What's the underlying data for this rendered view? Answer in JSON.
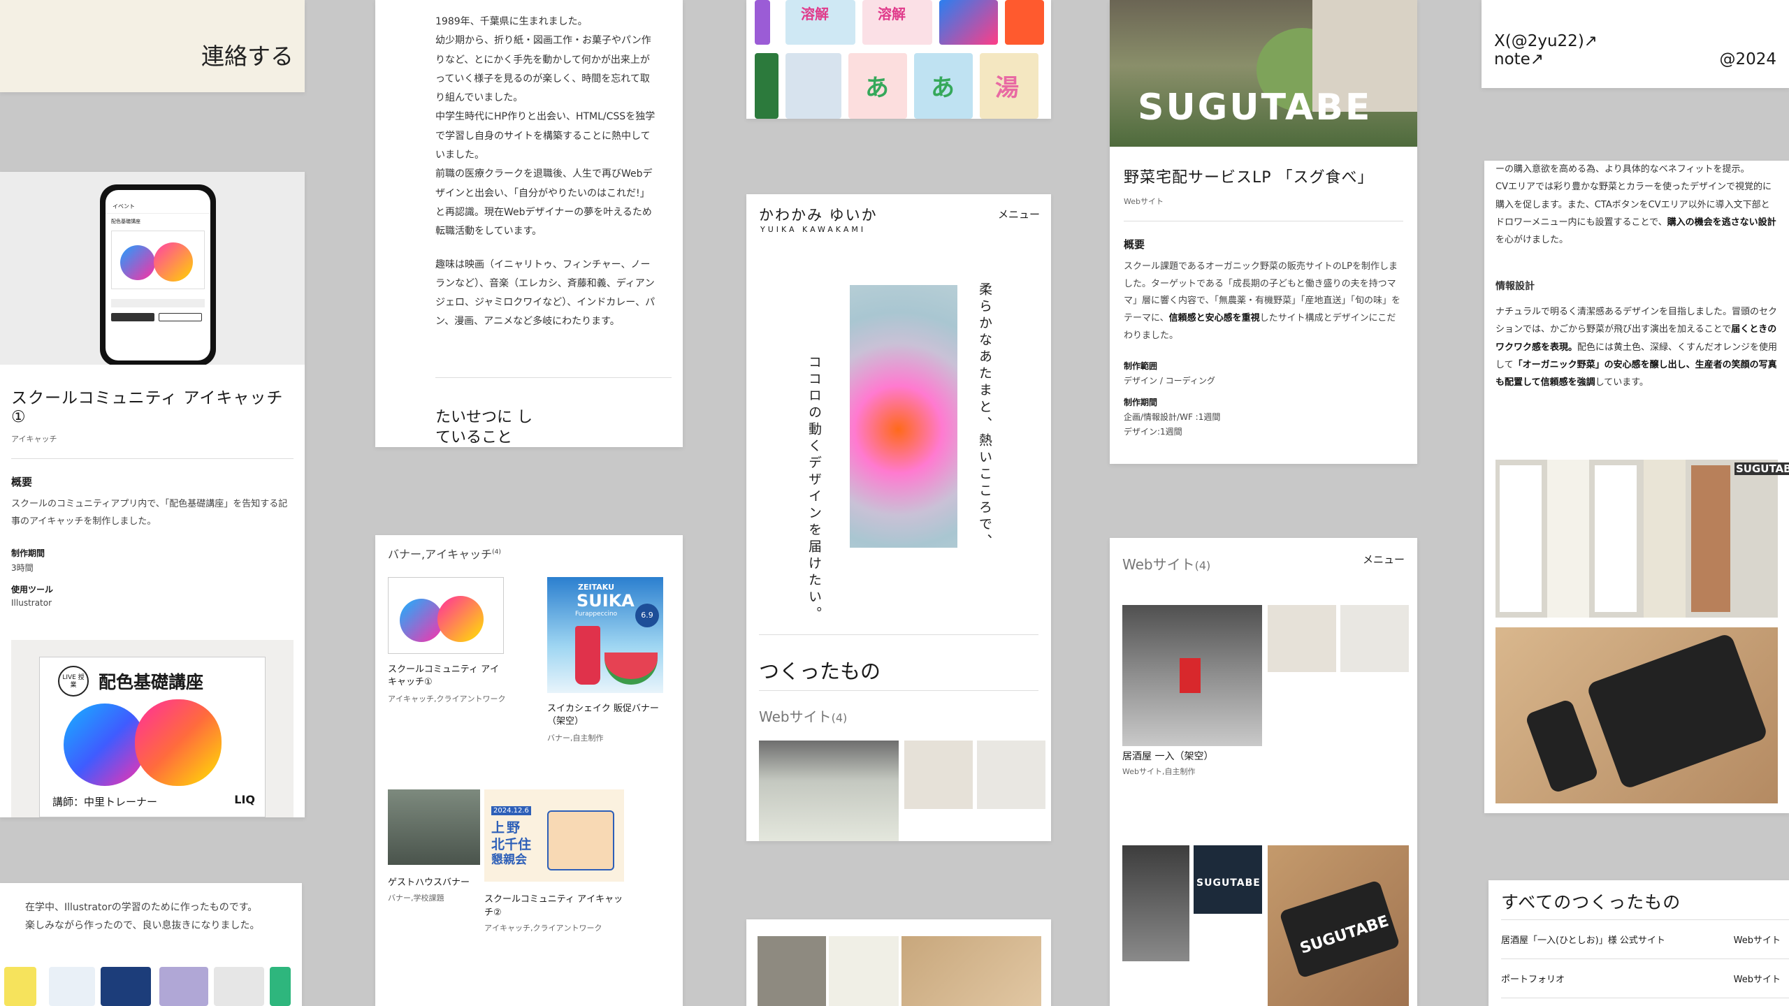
{
  "contact": {
    "label": "連絡する"
  },
  "card_school": {
    "title": "スクールコミュニティ アイキャッチ①",
    "category": "アイキャッチ",
    "overview_heading": "概要",
    "overview_text": "スクールのコミュニティアプリ内で、「配色基礎講座」を告知する記事のアイキャッチを制作しました。",
    "period_label": "制作期間",
    "period_value": "3時間",
    "tool_label": "使用ツール",
    "tool_value": "Illustrator",
    "phone_header": "イベント",
    "phone_sub": "配色基礎講座",
    "banner_live": "LIVE 授業",
    "banner_title": "配色基礎講座",
    "banner_teacher": "講師：中里トレーナー",
    "banner_brand": "LIQ"
  },
  "card_bio": {
    "p1": "1989年、千葉県に生まれました。",
    "p2": "幼少期から、折り紙・図画工作・お菓子やパン作りなど、とにかく手先を動かして何かが出来上がっていく様子を見るのが楽しく、時間を忘れて取り組んでいました。",
    "p3": "中学生時代にHP作りと出会い、HTML/CSSを独学で学習し自身のサイトを構築することに熱中していました。",
    "p4": "前職の医療クラークを退職後、人生で再びWebデザインと出会い、「自分がやりたいのはこれだ!」と再認識。現在Webデザイナーの夢を叶えるため転職活動をしています。",
    "p5": "趣味は映画（イニャリトゥ、フィンチャー、ノーランなど）、音楽（エレカシ、斉藤和義、ディアンジェロ、ジャミロクワイなど）、インドカレー、パン、漫画、アニメなど多岐にわたります。",
    "heading": "たいせつに していること"
  },
  "card_banner": {
    "heading": "バナー,アイキャッチ",
    "count": "(4)",
    "items": [
      {
        "title": "スクールコミュニティ アイキャッチ①",
        "tags": "アイキャッチ,クライアントワーク"
      },
      {
        "title": "スイカシェイク 販促バナー（架空）",
        "tags": "バナー,自主制作"
      },
      {
        "title": "ゲストハウスバナー",
        "tags": "バナー,学校課題"
      },
      {
        "title": "スクールコミュニティ アイキャッチ②",
        "tags": "アイキャッチ,クライアントワーク"
      }
    ],
    "suika_brand": "ZEITAKU",
    "suika_name": "SUIKA",
    "suika_sub": "Furappeccino",
    "suika_date": "6.9",
    "event_date": "2024.12.6",
    "event_place1": "上",
    "event_place2": "野",
    "event_place3": "北千住",
    "event_place4": "懇親会"
  },
  "card_note": {
    "text1": "在学中、Illustratorの学習のために作ったものです。",
    "text2": "楽しみながら作ったので、良い息抜きになりました。"
  },
  "card_hero": {
    "name_jp": "かわかみ ゆいか",
    "name_en": "YUIKA KAWAKAMI",
    "menu": "メニュー",
    "copy1": "柔らかなあたまと、熱いこころで、",
    "copy2": "ココロの動くデザインを届けたい。",
    "works_heading": "つくったもの",
    "web_label": "Webサイト",
    "web_count": "(4)"
  },
  "card_sugutabe": {
    "logo": "SUGUTABE",
    "title": "野菜宅配サービスLP 「スグ食べ」",
    "category": "Webサイト",
    "overview_heading": "概要",
    "overview_text1": "スクール課題であるオーガニック野菜の販売サイトのLPを制作しました。ターゲットである「成長期の子どもと働き盛りの夫を持つママ」層に響く内容で、「無農薬・有機野菜」「産地直送」「旬の味」をテーマに、",
    "overview_bold": "信頼感と安心感を重視",
    "overview_text2": "したサイト構成とデザインにこだわりました。",
    "scope_label": "制作範囲",
    "scope_value": "デザイン / コーディング",
    "period_label": "制作期間",
    "period_value1": "企画/情報設計/WF :1週間",
    "period_value2": "デザイン:1週間"
  },
  "card_web": {
    "heading": "Webサイト",
    "count": "(4)",
    "menu": "メニュー",
    "item_title": "居酒屋 一入（架空）",
    "item_tags": "Webサイト,自主制作",
    "logo2": "SUGUTABE",
    "logo3": "SUGUTABE"
  },
  "card_footer": {
    "x_link": "X(@2yu22)↗",
    "note_link": "note↗",
    "year": "@2024"
  },
  "card_info": {
    "p1": "ーの購入意欲を高める為、より具体的なベネフィットを提示。",
    "p2a": "CVエリアでは彩り豊かな野菜とカラーを使ったデザインで視覚的に購入を促します。また、CTAボタンをCVエリア以外に導入文下部とドロワーメニュー内にも設置することで、",
    "p2b": "購入の機会を逃さない設計",
    "p2c": "を心がけました。",
    "heading": "情報設計",
    "p3a": "ナチュラルで明るく清潔感あるデザインを目指しました。冒頭のセクションでは、かごから野菜が飛び出す演出を加えることで",
    "p3b": "届くときのワクワク感を表現。",
    "p3c": "配色には黄土色、深緑、くすんだオレンジを使用して",
    "p3d": "「オーガニック野菜」の安心感を醸し出し、生産者の笑顔の写真も配置して信頼感を強調",
    "p3e": "しています。",
    "logo": "SUGUTABE"
  },
  "card_all": {
    "heading": "すべてのつくったもの",
    "rows": [
      {
        "name": "居酒屋「一入(ひとしお)」様 公式サイト",
        "type": "Webサイト"
      },
      {
        "name": "ポートフォリオ",
        "type": "Webサイト"
      }
    ]
  },
  "card_colors": {
    "c1": "あ",
    "c2": "あ",
    "c3": "湯",
    "c4": "溶解",
    "c5": "溶解"
  }
}
